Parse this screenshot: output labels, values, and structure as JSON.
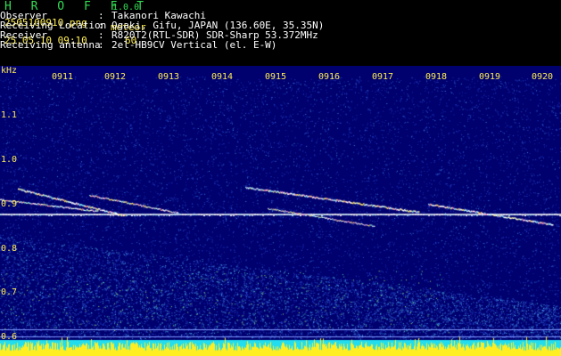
{
  "header": {
    "app_name": "H R O F F T",
    "version": "1.0.0",
    "filename": "2505100910.png",
    "mode_label": "meteor",
    "datetime": "25.05.10 09:10",
    "meteor_count": "60",
    "info": [
      {
        "key": "Observer",
        "value": "Takanori Kawachi"
      },
      {
        "key": "Receiving Location",
        "value": "Ogaki, Gifu, JAPAN (136.60E, 35.35N)"
      },
      {
        "key": "Receiver",
        "value": "R820T2(RTL-SDR) SDR-Sharp 53.372MHz"
      },
      {
        "key": "Receiving antenna",
        "value": "2el-HB9CV Vertical (el. E-W)"
      }
    ]
  },
  "spectrogram": {
    "y_unit": "kHz",
    "y_ticks": [
      "1.1",
      "1.0",
      "0.9",
      "0.8",
      "0.7",
      "0.6"
    ],
    "x_ticks": [
      "0911",
      "0912",
      "0913",
      "0914",
      "0915",
      "0916",
      "0917",
      "0918",
      "0919",
      "0920"
    ],
    "ylim": [
      0.57,
      1.16
    ],
    "colors": {
      "label": "#ffee55",
      "background": "#00006e",
      "trace": "#ffffff",
      "cyan": "#22ddee",
      "yellow": "#ffee22"
    }
  }
}
